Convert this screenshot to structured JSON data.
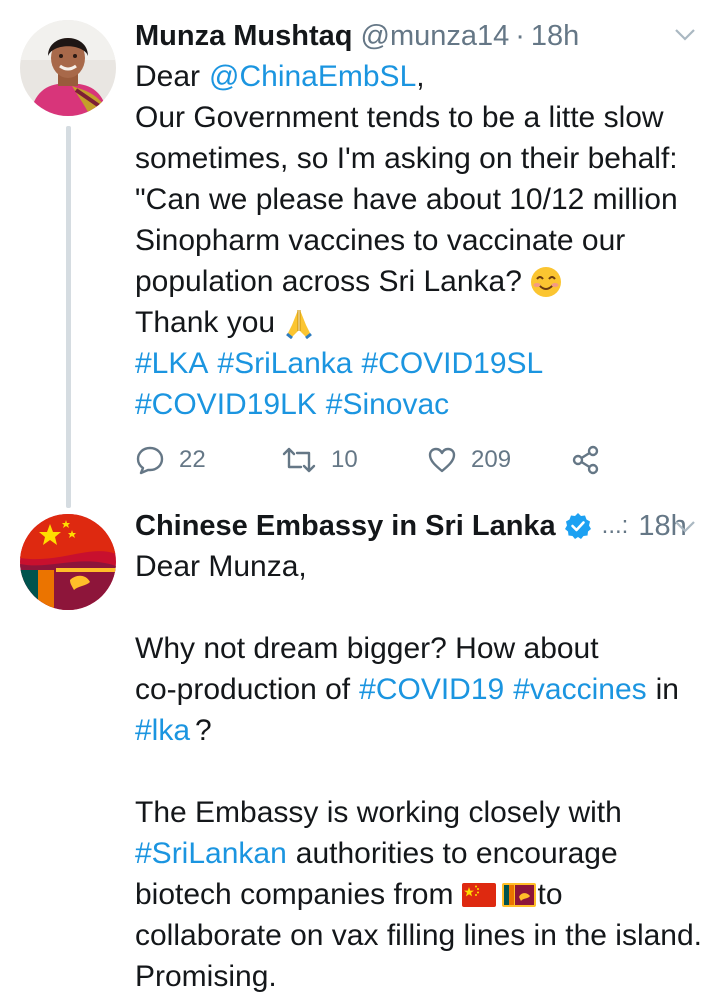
{
  "tweet1": {
    "author_name": "Munza Mushtaq",
    "handle": "@munza14",
    "separator": "·",
    "time": "18h",
    "lines": [
      {
        "a": "Dear",
        "b": "@ChinaEmbSL",
        "c": ","
      },
      "Our Government tends to be a litte slow",
      "sometimes, so I'm asking on their behalf:",
      "\"Can we please have about 10/12 million",
      "Sinopharm vaccines to vaccinate our",
      "population across Sri Lanka?",
      "Thank you"
    ],
    "hashtags_line1": [
      "#LKA",
      "#SriLanka",
      "#COVID19SL"
    ],
    "hashtags_line2": [
      "#COVID19LK",
      "#Sinovac"
    ],
    "replies": "22",
    "retweets": "10",
    "likes": "209"
  },
  "tweet2": {
    "author_name": "Chinese Embassy in Sri Lanka",
    "handle_truncated": "...:",
    "time": "18h",
    "lines": {
      "l1": "Dear Munza,",
      "l3": "Why not dream bigger? How about",
      "l4_a": "co-production of",
      "l4_b": "#COVID19",
      "l4_c": "#vaccines",
      "l4_d": "in",
      "l5_a": "#lka",
      "l5_b": "?",
      "l7": "The Embassy is working closely with",
      "l8_a": "#SriLankan",
      "l8_b": "authorities to encourage",
      "l9_a": "biotech companies from",
      "l9_b": "to",
      "l10": "collaborate on vax filling lines in the island.",
      "l11": "Promising."
    }
  },
  "colors": {
    "link": "#1b95e0",
    "secondary_text": "#657786",
    "thread_line": "#d5dce1",
    "verified_badge": "#1da1f2"
  },
  "icons": {
    "reply": "reply-icon",
    "retweet": "retweet-icon",
    "like": "heart-icon",
    "share": "share-icon",
    "more": "chevron-down-icon",
    "verified": "verified-badge-icon"
  }
}
